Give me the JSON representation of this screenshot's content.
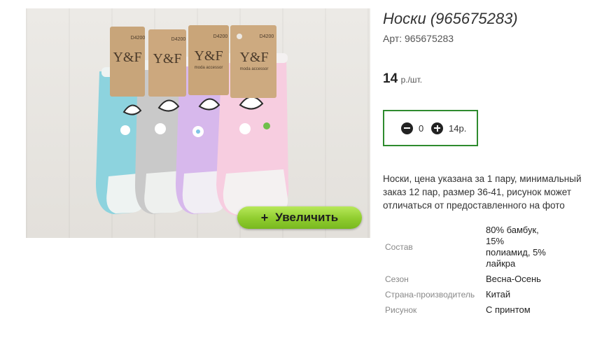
{
  "product": {
    "title": "Носки (965675283)",
    "sku": "Арт: 965675283",
    "price_value": "14",
    "price_unit": "р./шт.",
    "description": "Носки, цена указана за 1 пару, минимальный заказ 12 пар, размер 36-41, рисунок может отличаться от предоставленного на фото"
  },
  "image": {
    "brand_text": "Y&F",
    "brand_sub": "moda accessor",
    "tags": [
      "D4200",
      "D4200",
      "D4200",
      "D4200"
    ],
    "zoom_label": "Увеличить",
    "zoom_icon": "+",
    "colors": {
      "blue": "#8dd3de",
      "grey": "#c9c9c9",
      "lilac": "#d7b8ec",
      "pink": "#f7cde0"
    }
  },
  "cart": {
    "minus_icon": "minus-circle-icon",
    "plus_icon": "plus-circle-icon",
    "quantity": "0",
    "total": "14р.",
    "border_color": "#2e8b2e"
  },
  "specs": [
    {
      "label": "Состав",
      "value": "80% бамбук, 15% полиамид, 5% лайкра"
    },
    {
      "label": "Сезон",
      "value": "Весна-Осень"
    },
    {
      "label": "Страна-производитель",
      "value": "Китай"
    },
    {
      "label": "Рисунок",
      "value": "С принтом"
    }
  ]
}
